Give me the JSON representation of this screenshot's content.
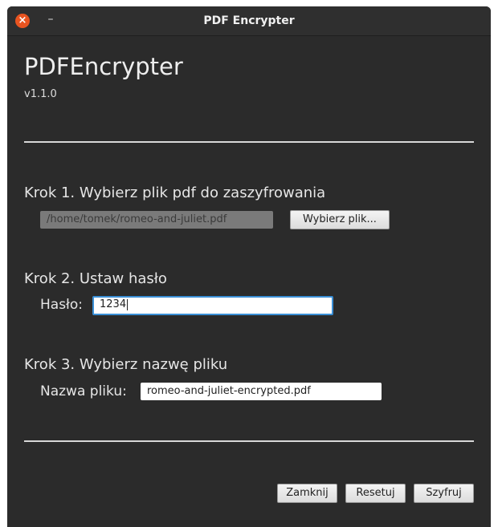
{
  "window": {
    "title": "PDF Encrypter",
    "close_icon": "×",
    "minimize_icon": "–"
  },
  "header": {
    "app_name": "PDFEncrypter",
    "version": "v1.1.0"
  },
  "step1": {
    "title": "Krok 1. Wybierz plik pdf do zaszyfrowania",
    "path_value": "/home/tomek/romeo-and-juliet.pdf",
    "choose_button": "Wybierz plik..."
  },
  "step2": {
    "title": "Krok 2. Ustaw hasło",
    "password_label": "Hasło:",
    "password_value": "1234"
  },
  "step3": {
    "title": "Krok 3. Wybierz nazwę pliku",
    "filename_label": "Nazwa pliku:",
    "filename_value": "romeo-and-juliet-encrypted.pdf"
  },
  "footer": {
    "close_button": "Zamknij",
    "reset_button": "Resetuj",
    "encrypt_button": "Szyfruj"
  },
  "colors": {
    "window_bg": "#2b2b2b",
    "close_button_bg": "#e95420",
    "focus_border": "#3a8fd6"
  }
}
